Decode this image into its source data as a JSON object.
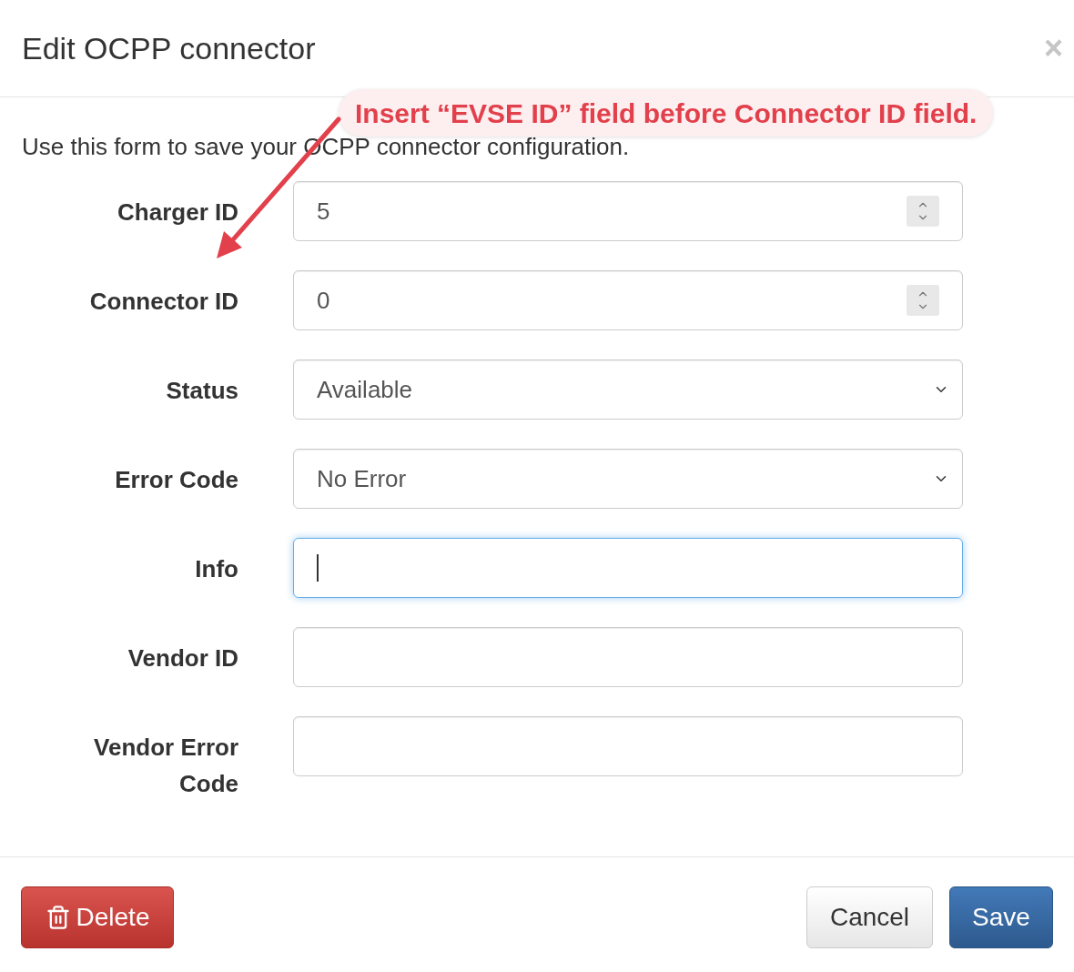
{
  "dialog": {
    "title": "Edit OCPP connector",
    "close": "×",
    "description": "Use this form to save your OCPP connector configuration."
  },
  "fields": [
    {
      "label": "Charger ID",
      "kind": "number",
      "value": "5",
      "focused": false
    },
    {
      "label": "Connector ID",
      "kind": "number",
      "value": "0",
      "focused": false
    },
    {
      "label": "Status",
      "kind": "select",
      "value": "Available",
      "focused": false
    },
    {
      "label": "Error Code",
      "kind": "select",
      "value": "No Error",
      "focused": false
    },
    {
      "label": "Info",
      "kind": "text",
      "focused": true
    },
    {
      "label": "Vendor ID",
      "kind": "text",
      "focused": false
    },
    {
      "label": "Vendor Error Code",
      "kind": "text",
      "focused": false
    }
  ],
  "buttons": [
    {
      "label": "Delete",
      "kind": "danger"
    },
    {
      "label": "Cancel",
      "kind": "default"
    },
    {
      "label": "Save",
      "kind": "primary"
    }
  ],
  "annotation": {
    "text": "Insert “EVSE ID” field before Connector ID field."
  }
}
